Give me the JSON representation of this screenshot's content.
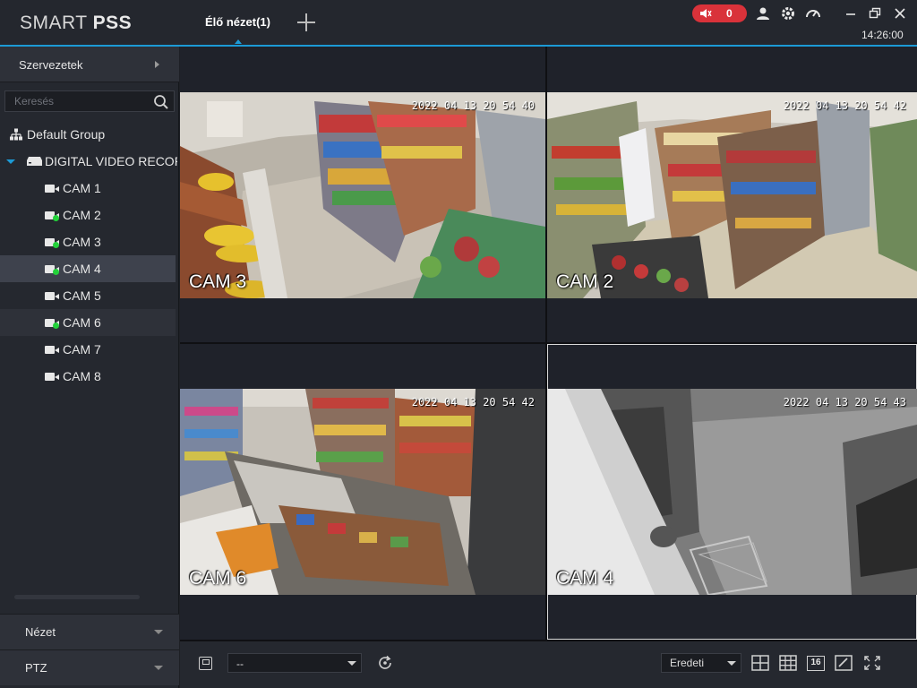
{
  "app": {
    "logo_light": "SMART ",
    "logo_bold": "PSS",
    "active_tab": "Élő nézet(1)",
    "alarm_count": "0",
    "clock": "14:26:00",
    "accent_color": "#1c9ad6",
    "alarm_color": "#d9323a",
    "online_color": "#23d13a"
  },
  "sidebar": {
    "org_header": "Szervezetek",
    "search_placeholder": "Keresés",
    "tree": {
      "group": "Default Group",
      "device": "DIGITAL VIDEO RECOR",
      "cameras": [
        {
          "label": "CAM 1",
          "online": false
        },
        {
          "label": "CAM 2",
          "online": true
        },
        {
          "label": "CAM 3",
          "online": true
        },
        {
          "label": "CAM 4",
          "online": true,
          "selected": true
        },
        {
          "label": "CAM 5",
          "online": false
        },
        {
          "label": "CAM 6",
          "online": true
        },
        {
          "label": "CAM 7",
          "online": false
        },
        {
          "label": "CAM 8",
          "online": false
        }
      ]
    },
    "sections": [
      "Nézet",
      "PTZ"
    ]
  },
  "video": {
    "cells": [
      {
        "cam": "CAM 3",
        "timestamp": "2022 04 13  20 54 40"
      },
      {
        "cam": "CAM 2",
        "timestamp": "2022 04 13  20 54 42"
      },
      {
        "cam": "CAM 6",
        "timestamp": "2022 04 13  20 54 42"
      },
      {
        "cam": "CAM 4",
        "timestamp": "2022 04 13  20 54 43"
      }
    ]
  },
  "toolbar": {
    "layout_value": "--",
    "ratio_value": "Eredeti",
    "grid16_label": "16"
  }
}
